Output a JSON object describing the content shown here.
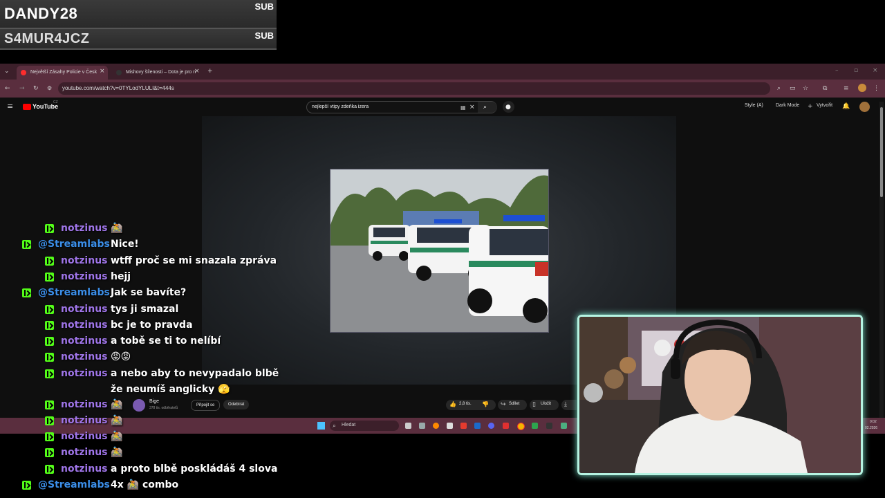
{
  "alerts": [
    {
      "name": "DANDY28",
      "tag": "SUB"
    },
    {
      "name": "S4MUR4JCZ",
      "tag": "SUB"
    }
  ],
  "browser": {
    "tabs": [
      {
        "label": "Největší Zásahy Policie v Česk"
      },
      {
        "label": "Mishovy šílenosti – Dota je pro n"
      }
    ],
    "url": "youtube.com/watch?v=0TYLodYLULI&t=444s"
  },
  "youtube": {
    "logo": "YouTube",
    "logo_sup": "CZ",
    "search_value": "nejlepší vtipy zdeňka izera",
    "style_label": "Style (A)",
    "dark_mode_label": "Dark Mode",
    "create_label": "Vytvořit",
    "channel_name": "Bige",
    "subscribers": "378 tis. odběratelů",
    "join_label": "Připojit se",
    "subscribe_label": "Odebírat",
    "likes": "2,8 tis.",
    "share_label": "Sdílet",
    "save_label": "Uložit"
  },
  "taskbar": {
    "search_placeholder": "Hledat",
    "time": "0:02",
    "date": "02.2026"
  },
  "chat": [
    {
      "user": "notzinus",
      "text": "🚵",
      "type": "kick"
    },
    {
      "user": "@Streamlabs",
      "text": "Nice!",
      "type": "bot"
    },
    {
      "user": "notzinus",
      "text": "wtff proč se mi snazala zpráva",
      "type": "kick"
    },
    {
      "user": "notzinus",
      "text": "hejj",
      "type": "kick"
    },
    {
      "user": "@Streamlabs",
      "text": "Jak se bavíte?",
      "type": "bot"
    },
    {
      "user": "notzinus",
      "text": "tys ji smazal",
      "type": "kick"
    },
    {
      "user": "notzinus",
      "text": "bc je to pravda",
      "type": "kick"
    },
    {
      "user": "notzinus",
      "text": "a tobě se ti to nelíbí",
      "type": "kick"
    },
    {
      "user": "notzinus",
      "text": "😡😡",
      "type": "kick"
    },
    {
      "user": "notzinus",
      "text": "a nebo aby to nevypadalo blbě",
      "text2": "že neumíš anglicky 🫣",
      "type": "kick"
    },
    {
      "user": "notzinus",
      "text": "🚵",
      "type": "kick"
    },
    {
      "user": "notzinus",
      "text": "🚵",
      "type": "kick"
    },
    {
      "user": "notzinus",
      "text": "🚵",
      "type": "kick"
    },
    {
      "user": "notzinus",
      "text": "🚵",
      "type": "kick"
    },
    {
      "user": "notzinus",
      "text": "a proto blbě poskládáš 4 slova",
      "type": "kick"
    },
    {
      "user": "@Streamlabs",
      "text": "4x 🚵 combo",
      "type": "bot"
    }
  ],
  "colors": {
    "kick_green": "#53fc18",
    "notzinus": "#9f75e8",
    "streamlabs": "#3b8ee8",
    "webcam_border": "#b6f4e2"
  }
}
